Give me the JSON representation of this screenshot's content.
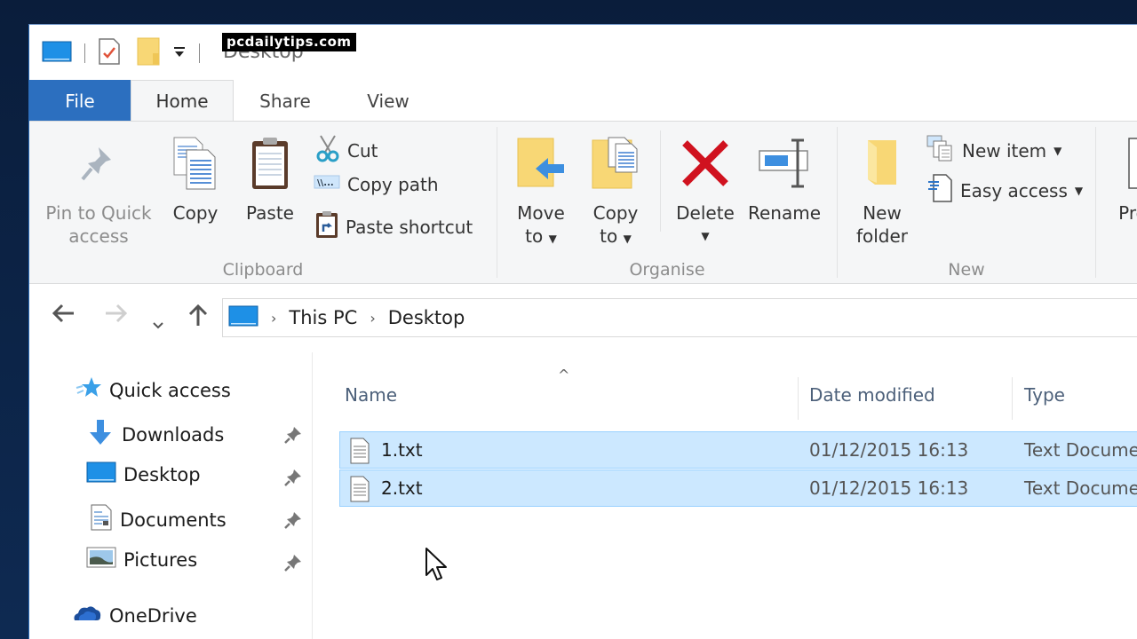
{
  "watermark": "pcdailytips.com",
  "window": {
    "title": "Desktop",
    "qat_icons": [
      "desktop-icon",
      "properties-icon",
      "new-folder-icon",
      "customize-dropdown-icon"
    ]
  },
  "tabs": [
    {
      "label": "File",
      "state": "file"
    },
    {
      "label": "Home",
      "state": "active"
    },
    {
      "label": "Share",
      "state": "inactive"
    },
    {
      "label": "View",
      "state": "inactive"
    }
  ],
  "ribbon": {
    "clipboard": {
      "label": "Clipboard",
      "pin_line1": "Pin to Quick",
      "pin_line2": "access",
      "copy": "Copy",
      "paste": "Paste",
      "cut": "Cut",
      "copy_path": "Copy path",
      "paste_shortcut": "Paste shortcut"
    },
    "organise": {
      "label": "Organise",
      "move_line1": "Move",
      "move_line2": "to",
      "copy_line1": "Copy",
      "copy_line2": "to",
      "delete": "Delete",
      "rename": "Rename"
    },
    "new": {
      "label": "New",
      "folder_line1": "New",
      "folder_line2": "folder",
      "new_item": "New item",
      "easy_access": "Easy access"
    },
    "open": {
      "properties_partial": "Pro"
    }
  },
  "address": {
    "crumbs": [
      "This PC",
      "Desktop"
    ]
  },
  "navpane": {
    "quick_access": "Quick access",
    "items": [
      {
        "label": "Downloads",
        "icon": "downloads-icon",
        "pinned": true
      },
      {
        "label": "Desktop",
        "icon": "desktop-icon",
        "pinned": true
      },
      {
        "label": "Documents",
        "icon": "documents-icon",
        "pinned": true
      },
      {
        "label": "Pictures",
        "icon": "pictures-icon",
        "pinned": true
      }
    ],
    "onedrive": "OneDrive"
  },
  "filelist": {
    "columns": [
      "Name",
      "Date modified",
      "Type"
    ],
    "rows": [
      {
        "name": "1.txt",
        "date": "01/12/2015 16:13",
        "type": "Text Document",
        "selected": true
      },
      {
        "name": "2.txt",
        "date": "01/12/2015 16:13",
        "type": "Text Document",
        "selected": true
      }
    ]
  },
  "colors": {
    "file_tab": "#2c6fbf",
    "selection": "#cce8ff",
    "selection_border": "#99d1ff",
    "delete_red": "#d0121f",
    "folder_yellow": "#f8d775"
  }
}
